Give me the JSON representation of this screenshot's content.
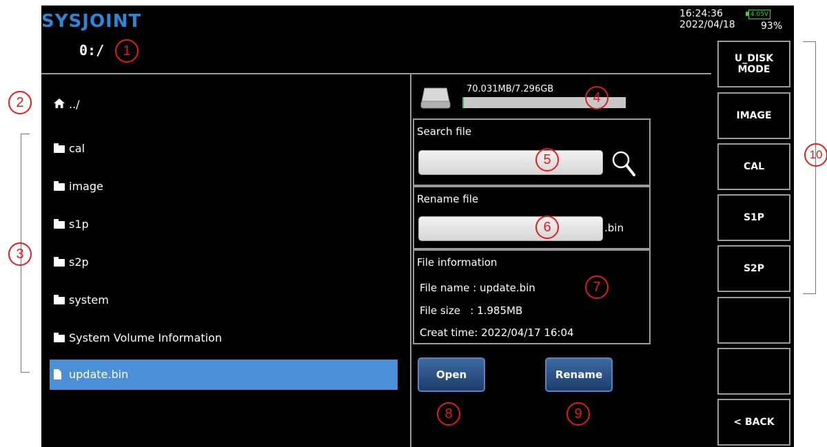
{
  "header": {
    "brand": "SYSJOINT",
    "path": "0:/",
    "time": "16:24:36",
    "date": "2022/04/18",
    "battery_voltage": "4.05V",
    "battery_percent": "93%"
  },
  "file_list": {
    "up": "../",
    "items": [
      {
        "name": "cal",
        "type": "folder"
      },
      {
        "name": "image",
        "type": "folder"
      },
      {
        "name": "s1p",
        "type": "folder"
      },
      {
        "name": "s2p",
        "type": "folder"
      },
      {
        "name": "system",
        "type": "folder"
      },
      {
        "name": "System Volume Information",
        "type": "folder"
      },
      {
        "name": "update.bin",
        "type": "file",
        "selected": true
      }
    ]
  },
  "storage": {
    "usage_text": "70.031MB/7.296GB",
    "used_fraction": 0.01
  },
  "search": {
    "title": "Search file",
    "value": ""
  },
  "rename": {
    "title": "Rename file",
    "value": "",
    "extension": ".bin"
  },
  "info": {
    "title": "File information",
    "name_line": "File name : update.bin",
    "size_line": "File size   : 1.985MB",
    "time_line": "Creat time: 2022/04/17 16:04"
  },
  "buttons": {
    "open": "Open",
    "rename": "Rename"
  },
  "softkeys": [
    "U_DISK\nMODE",
    "IMAGE",
    "CAL",
    "S1P",
    "S2P",
    "",
    "",
    "< BACK"
  ],
  "annotations": [
    "1",
    "2",
    "3",
    "4",
    "5",
    "6",
    "7",
    "8",
    "9",
    "10"
  ],
  "colors": {
    "brand": "#2f86d6",
    "selection": "#4a8fd8",
    "button": "#2a5289",
    "annotation": "#e21b1b",
    "usage_fill": "#2fbf55"
  }
}
